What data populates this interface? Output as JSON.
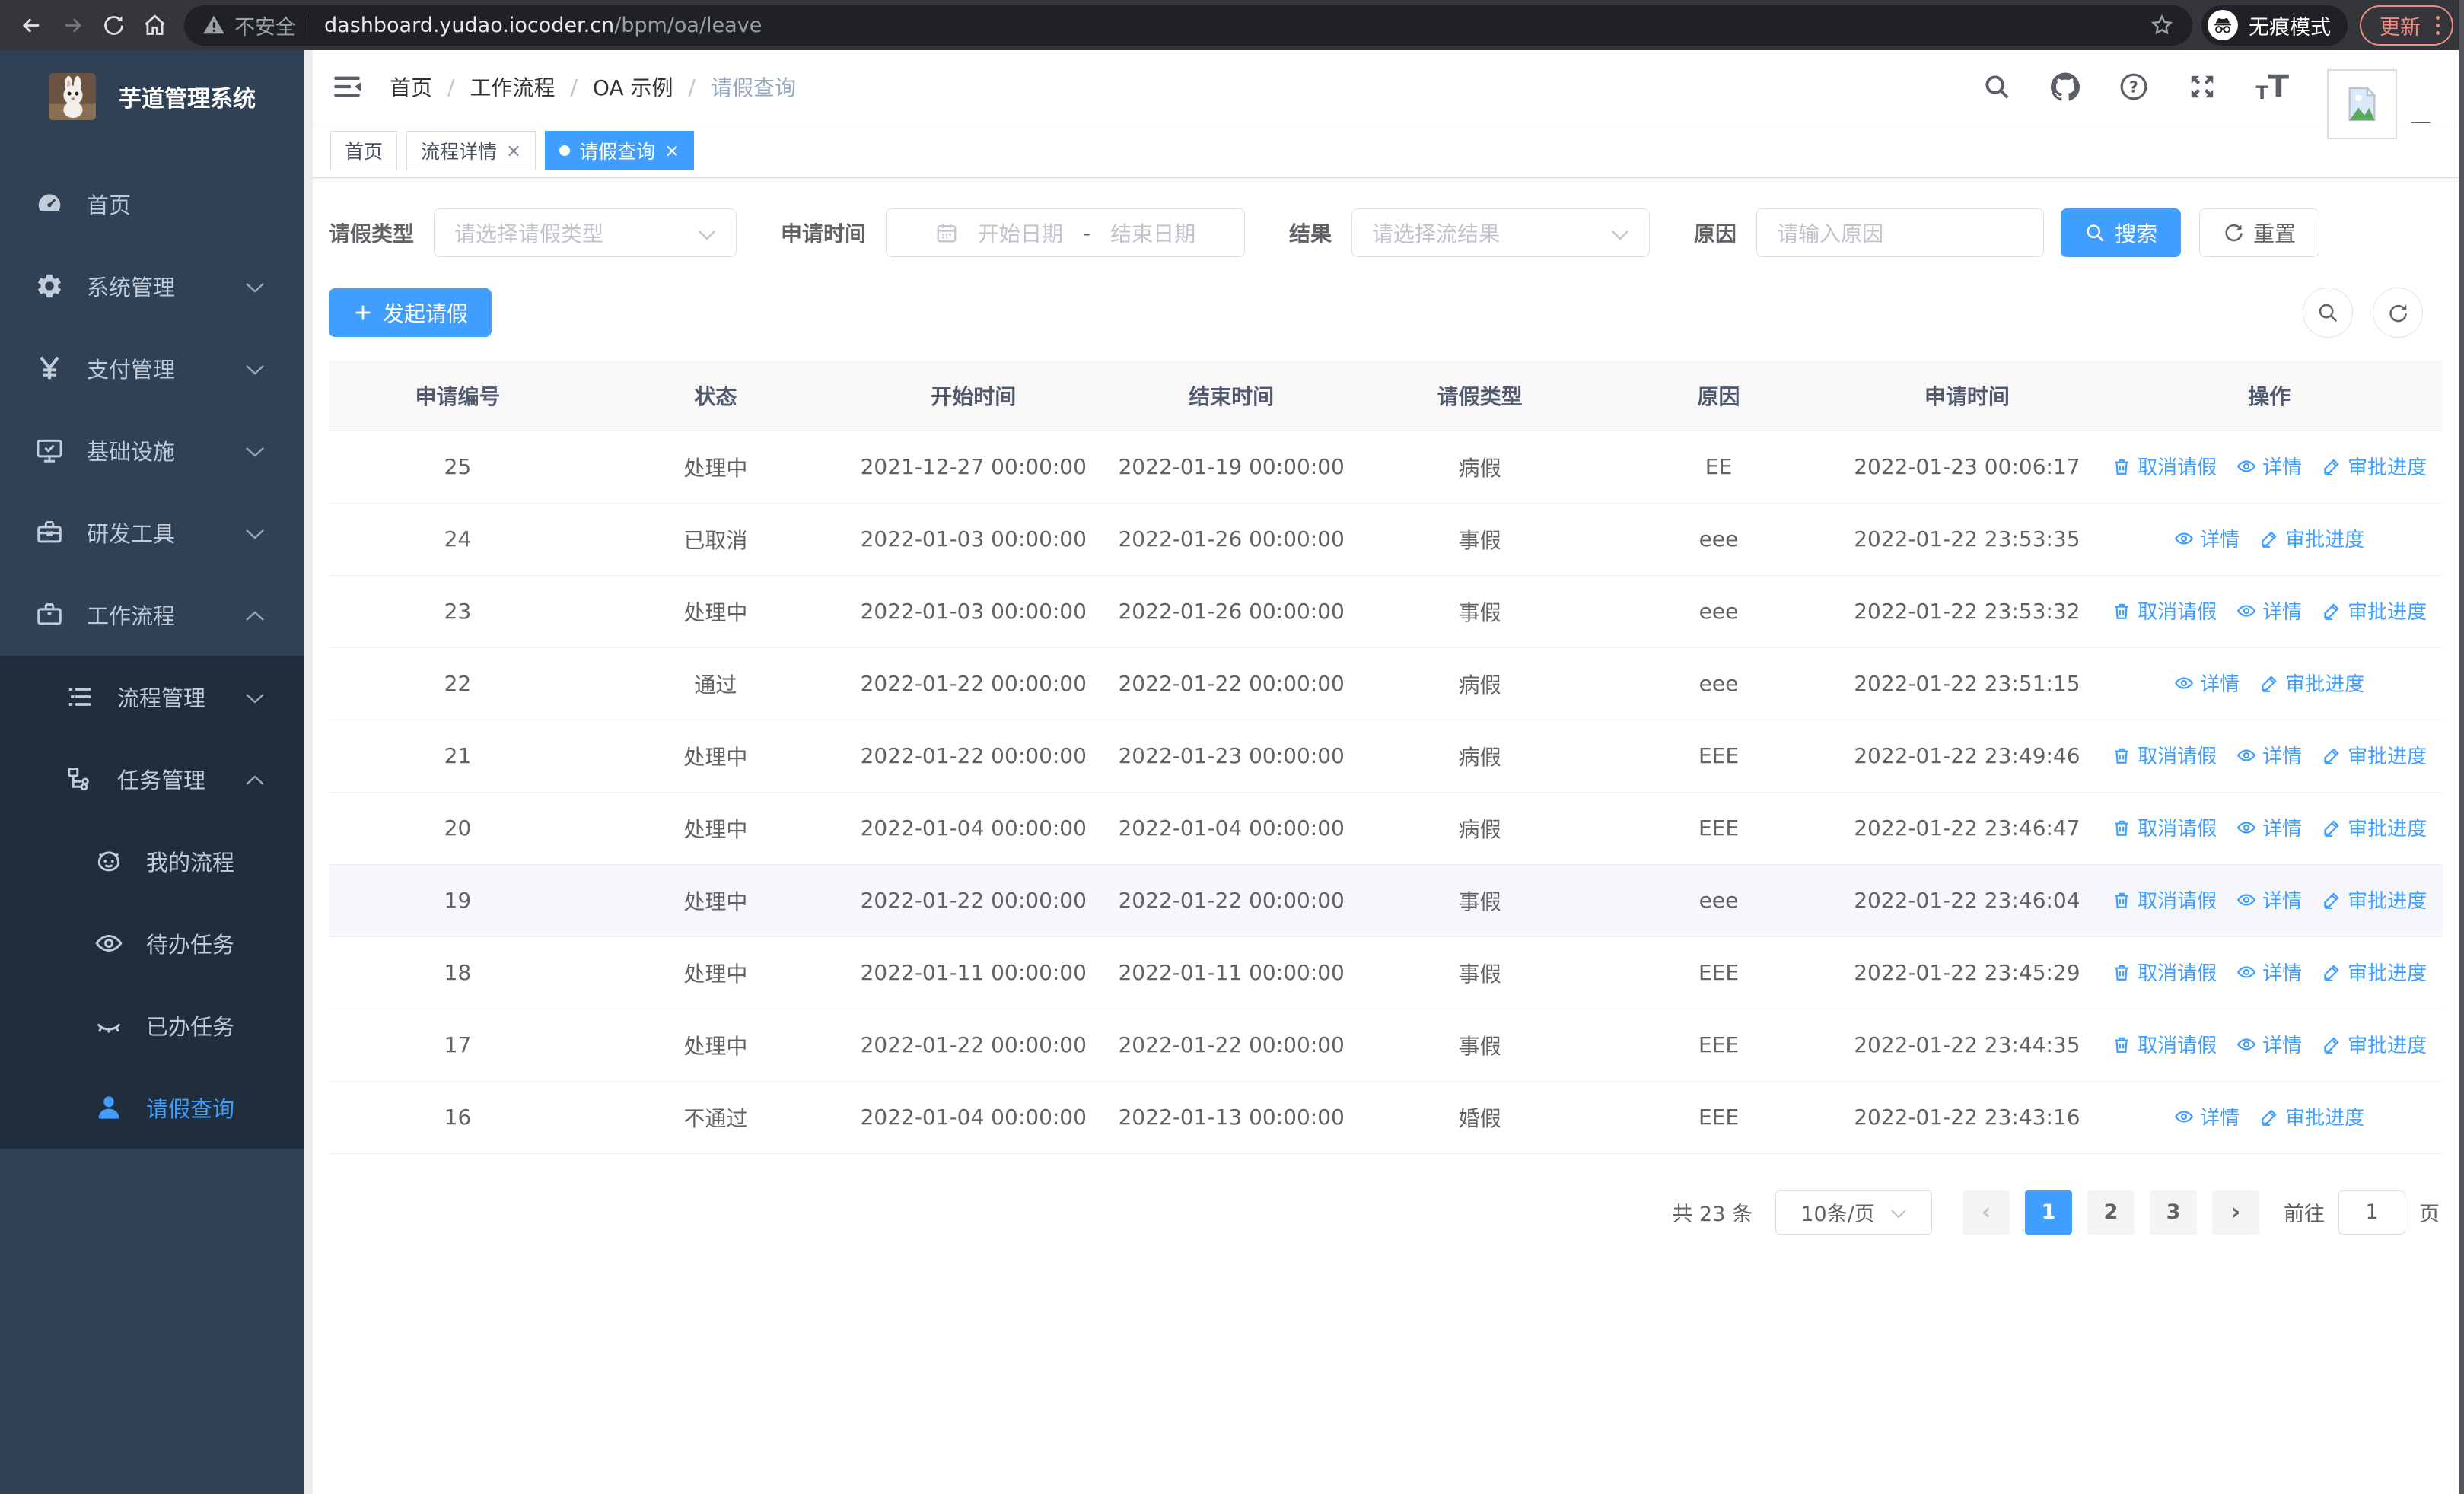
{
  "colors": {
    "primary": "#409eff",
    "sidebar_bg": "#304156",
    "submenu_bg": "#1f2d3d",
    "update_accent": "#f28b82"
  },
  "browser": {
    "insecure_label": "不安全",
    "url_host": "dashboard.yudao.iocoder.cn",
    "url_path": "/bpm/oa/leave",
    "incognito_label": "无痕模式",
    "update_label": "更新"
  },
  "sidebar": {
    "title": "芋道管理系统",
    "menu": [
      {
        "label": "首页",
        "icon": "dashboard-icon",
        "level": 1,
        "chevron": "",
        "sub": false,
        "active": false
      },
      {
        "label": "系统管理",
        "icon": "gear-icon",
        "level": 1,
        "chevron": "down",
        "sub": false,
        "active": false
      },
      {
        "label": "支付管理",
        "icon": "yen-icon",
        "level": 1,
        "chevron": "down",
        "sub": false,
        "active": false
      },
      {
        "label": "基础设施",
        "icon": "monitor-icon",
        "level": 1,
        "chevron": "down",
        "sub": false,
        "active": false
      },
      {
        "label": "研发工具",
        "icon": "toolbox-icon",
        "level": 1,
        "chevron": "down",
        "sub": false,
        "active": false
      },
      {
        "label": "工作流程",
        "icon": "briefcase-icon",
        "level": 1,
        "chevron": "up",
        "sub": false,
        "active": false
      },
      {
        "label": "流程管理",
        "icon": "list-icon",
        "level": 2,
        "chevron": "down",
        "sub": true,
        "active": false
      },
      {
        "label": "任务管理",
        "icon": "flow-icon",
        "level": 2,
        "chevron": "up",
        "sub": true,
        "active": false
      },
      {
        "label": "我的流程",
        "icon": "face-icon",
        "level": 3,
        "chevron": "",
        "sub": true,
        "active": false
      },
      {
        "label": "待办任务",
        "icon": "eye-icon",
        "level": 3,
        "chevron": "",
        "sub": true,
        "active": false
      },
      {
        "label": "已办任务",
        "icon": "eye-closed-icon",
        "level": 3,
        "chevron": "",
        "sub": true,
        "active": false
      },
      {
        "label": "请假查询",
        "icon": "user-icon",
        "level": 3,
        "chevron": "",
        "sub": true,
        "active": true
      }
    ]
  },
  "header": {
    "breadcrumb": [
      "首页",
      "工作流程",
      "OA 示例",
      "请假查询"
    ],
    "separator": "/"
  },
  "tabs": [
    {
      "label": "首页",
      "closable": false,
      "active": false
    },
    {
      "label": "流程详情",
      "closable": true,
      "active": false
    },
    {
      "label": "请假查询",
      "closable": true,
      "active": true
    }
  ],
  "filters": {
    "leave_type": {
      "label": "请假类型",
      "placeholder": "请选择请假类型"
    },
    "apply_time": {
      "label": "申请时间",
      "start_placeholder": "开始日期",
      "separator": "-",
      "end_placeholder": "结束日期"
    },
    "result": {
      "label": "结果",
      "placeholder": "请选择流结果"
    },
    "reason": {
      "label": "原因",
      "placeholder": "请输入原因"
    },
    "search_label": "搜索",
    "reset_label": "重置"
  },
  "toolbar": {
    "create_label": "发起请假"
  },
  "table": {
    "columns": [
      "申请编号",
      "状态",
      "开始时间",
      "结束时间",
      "请假类型",
      "原因",
      "申请时间",
      "操作"
    ],
    "action_labels": {
      "cancel": "取消请假",
      "detail": "详情",
      "progress": "审批进度"
    },
    "highlighted_id": "19",
    "rows": [
      {
        "id": "25",
        "status": "处理中",
        "start": "2021-12-27 00:00:00",
        "end": "2022-01-19 00:00:00",
        "type": "病假",
        "reason": "EE",
        "apply": "2022-01-23 00:06:17",
        "actions": [
          "cancel",
          "detail",
          "progress"
        ]
      },
      {
        "id": "24",
        "status": "已取消",
        "start": "2022-01-03 00:00:00",
        "end": "2022-01-26 00:00:00",
        "type": "事假",
        "reason": "eee",
        "apply": "2022-01-22 23:53:35",
        "actions": [
          "detail",
          "progress"
        ]
      },
      {
        "id": "23",
        "status": "处理中",
        "start": "2022-01-03 00:00:00",
        "end": "2022-01-26 00:00:00",
        "type": "事假",
        "reason": "eee",
        "apply": "2022-01-22 23:53:32",
        "actions": [
          "cancel",
          "detail",
          "progress"
        ]
      },
      {
        "id": "22",
        "status": "通过",
        "start": "2022-01-22 00:00:00",
        "end": "2022-01-22 00:00:00",
        "type": "病假",
        "reason": "eee",
        "apply": "2022-01-22 23:51:15",
        "actions": [
          "detail",
          "progress"
        ]
      },
      {
        "id": "21",
        "status": "处理中",
        "start": "2022-01-22 00:00:00",
        "end": "2022-01-23 00:00:00",
        "type": "病假",
        "reason": "EEE",
        "apply": "2022-01-22 23:49:46",
        "actions": [
          "cancel",
          "detail",
          "progress"
        ]
      },
      {
        "id": "20",
        "status": "处理中",
        "start": "2022-01-04 00:00:00",
        "end": "2022-01-04 00:00:00",
        "type": "病假",
        "reason": "EEE",
        "apply": "2022-01-22 23:46:47",
        "actions": [
          "cancel",
          "detail",
          "progress"
        ]
      },
      {
        "id": "19",
        "status": "处理中",
        "start": "2022-01-22 00:00:00",
        "end": "2022-01-22 00:00:00",
        "type": "事假",
        "reason": "eee",
        "apply": "2022-01-22 23:46:04",
        "actions": [
          "cancel",
          "detail",
          "progress"
        ]
      },
      {
        "id": "18",
        "status": "处理中",
        "start": "2022-01-11 00:00:00",
        "end": "2022-01-11 00:00:00",
        "type": "事假",
        "reason": "EEE",
        "apply": "2022-01-22 23:45:29",
        "actions": [
          "cancel",
          "detail",
          "progress"
        ]
      },
      {
        "id": "17",
        "status": "处理中",
        "start": "2022-01-22 00:00:00",
        "end": "2022-01-22 00:00:00",
        "type": "事假",
        "reason": "EEE",
        "apply": "2022-01-22 23:44:35",
        "actions": [
          "cancel",
          "detail",
          "progress"
        ]
      },
      {
        "id": "16",
        "status": "不通过",
        "start": "2022-01-04 00:00:00",
        "end": "2022-01-13 00:00:00",
        "type": "婚假",
        "reason": "EEE",
        "apply": "2022-01-22 23:43:16",
        "actions": [
          "detail",
          "progress"
        ]
      }
    ]
  },
  "pagination": {
    "total_text": "共 23 条",
    "page_size": "10条/页",
    "pages": [
      "1",
      "2",
      "3"
    ],
    "active_page": "1",
    "goto_label": "前往",
    "goto_value": "1",
    "goto_unit": "页"
  }
}
